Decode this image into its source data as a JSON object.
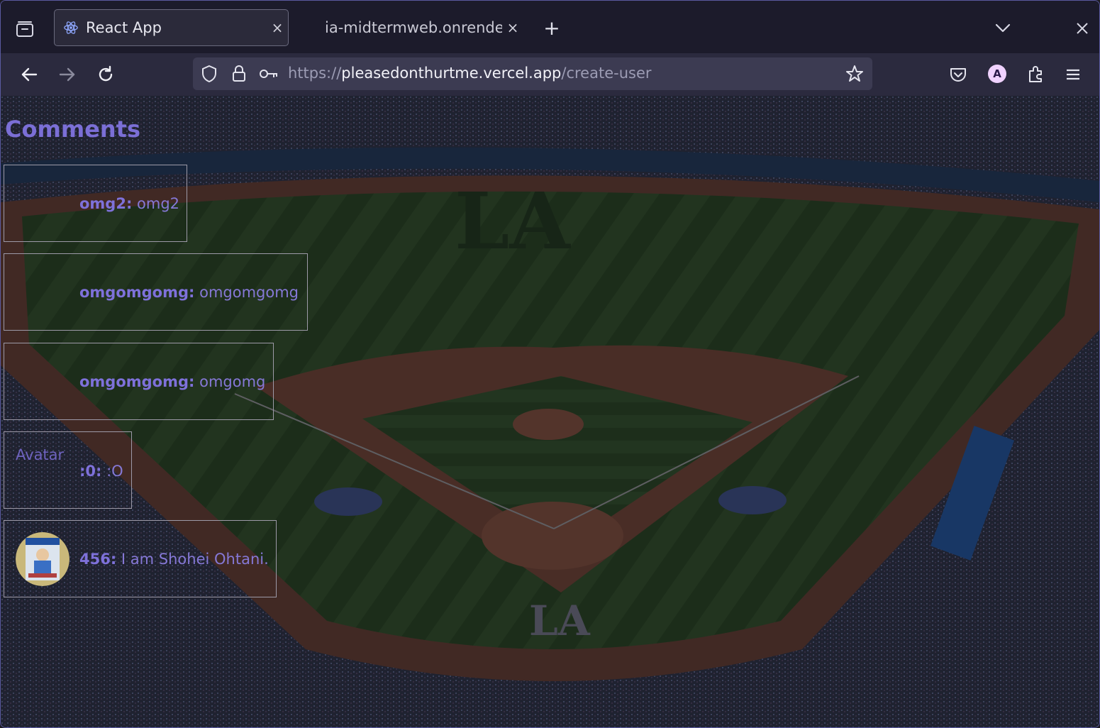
{
  "browser": {
    "tabs": [
      {
        "title": "React App",
        "active": true,
        "icon": "react-icon"
      },
      {
        "title": "ia-midtermweb.onrende",
        "active": false
      }
    ],
    "close_glyph": "×",
    "new_tab_glyph": "+",
    "url": {
      "scheme": "https://",
      "host": "pleasedonthurtme.vercel.app",
      "path": "/create-user"
    },
    "account_initial": "A"
  },
  "page": {
    "heading": "Comments",
    "comments": [
      {
        "user": "omg2:",
        "text": " omg2"
      },
      {
        "user": "omgomgomg:",
        "text": " omgomgomg"
      },
      {
        "user": "omgomgomg:",
        "text": " omgomg"
      },
      {
        "user": ":0:",
        "text": " :O",
        "avatar_alt": "Avatar"
      },
      {
        "user": "456:",
        "text": " I am Shohei Ohtani.",
        "avatar": "player-card-photo"
      }
    ]
  },
  "colors": {
    "accent": "#7b6fd6",
    "field_green": "#2d4a22",
    "dirt": "#6b3f2e",
    "toolbar": "#2b2a3e"
  }
}
